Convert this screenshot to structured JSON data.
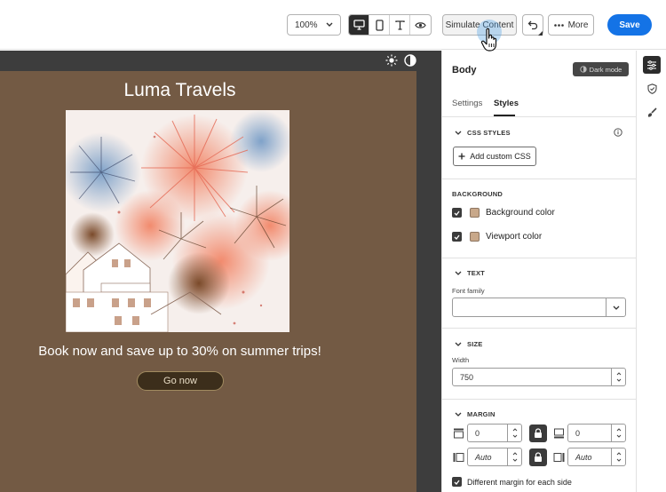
{
  "toolbar": {
    "zoom": "100%",
    "simulate_label": "Simulate Content",
    "more_label": "More",
    "save_label": "Save",
    "accent": "#1473e6"
  },
  "email": {
    "title": "Luma Travels",
    "body_text": "Book now and save up to 30% on summer trips!",
    "cta_label": "Go now",
    "background": "#735a44"
  },
  "panel": {
    "title": "Body",
    "dark_mode_label": "Dark mode",
    "tabs": [
      {
        "label": "Settings",
        "active": false
      },
      {
        "label": "Styles",
        "active": true
      }
    ],
    "css_styles": {
      "heading": "CSS STYLES",
      "add_label": "Add custom CSS"
    },
    "background": {
      "heading": "BACKGROUND",
      "items": [
        {
          "label": "Background color",
          "checked": true,
          "color": "#c8a88a"
        },
        {
          "label": "Viewport color",
          "checked": true,
          "color": "#c8a88a"
        }
      ]
    },
    "text": {
      "heading": "TEXT",
      "font_family_label": "Font family",
      "font_family_value": ""
    },
    "size": {
      "heading": "SIZE",
      "width_label": "Width",
      "width_value": "750"
    },
    "margin": {
      "heading": "MARGIN",
      "top": "0",
      "bottom": "0",
      "left": "Auto",
      "right": "Auto",
      "different_label": "Different margin for each side",
      "different_checked": true
    }
  },
  "icons": {
    "rail": [
      "sliders-icon",
      "shield-icon",
      "brush-icon"
    ]
  }
}
